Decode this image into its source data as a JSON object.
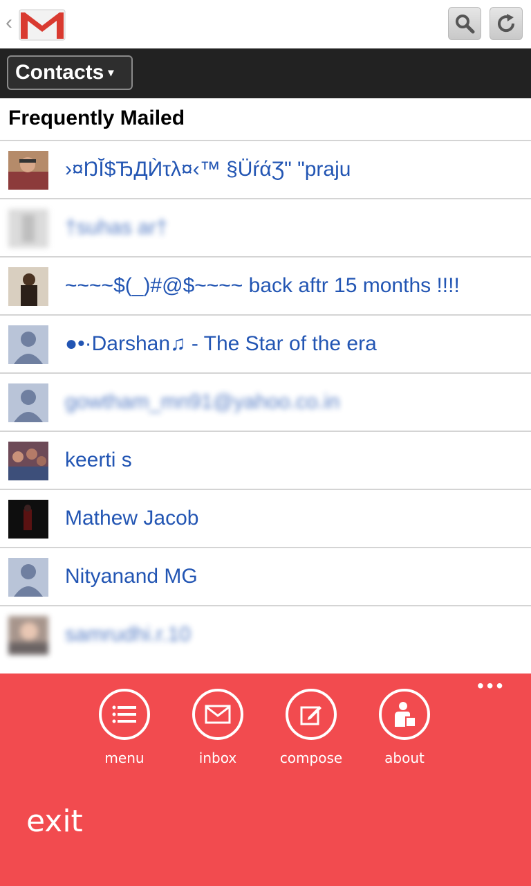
{
  "header": {
    "back_glyph": "‹",
    "logo_name": "gmail-logo",
    "search_icon": "search-icon",
    "refresh_icon": "refresh-icon"
  },
  "toolbar": {
    "contacts_label": "Contacts",
    "caret": "▾"
  },
  "section_title": "Frequently Mailed",
  "contacts": [
    {
      "name": "›¤ŊĬ$ЂДЍτλ¤‹™ §ÜŕάƷ\" \"praju",
      "avatar": "photo-person",
      "blurred": false
    },
    {
      "name": "†suhas ar†",
      "avatar": "photo-grey",
      "blurred": true
    },
    {
      "name": "~~~~$(_)#@$~~~~ back aftr 15 months !!!!",
      "avatar": "photo-dark",
      "blurred": false
    },
    {
      "name": "●•·Darshan♫ - The Star of the era",
      "avatar": "default-avatar",
      "blurred": false
    },
    {
      "name": "gowtham_mn91@yahoo.co.in",
      "avatar": "default-avatar",
      "blurred": true
    },
    {
      "name": "keerti s",
      "avatar": "photo-group",
      "blurred": false
    },
    {
      "name": "Mathew Jacob",
      "avatar": "photo-dark-red",
      "blurred": false
    },
    {
      "name": "Nityanand MG",
      "avatar": "default-avatar",
      "blurred": false
    },
    {
      "name": "samrudhi.r.10",
      "avatar": "photo-blurred",
      "blurred": true
    }
  ],
  "appbar": {
    "more": "•••",
    "buttons": [
      {
        "label": "menu",
        "icon": "menu-icon"
      },
      {
        "label": "inbox",
        "icon": "mail-icon"
      },
      {
        "label": "compose",
        "icon": "compose-icon"
      },
      {
        "label": "about",
        "icon": "about-icon"
      }
    ],
    "exit_label": "exit"
  },
  "colors": {
    "appbar_bg": "#f24b4f",
    "link_blue": "#2255b3",
    "dark_bar": "#222222"
  }
}
